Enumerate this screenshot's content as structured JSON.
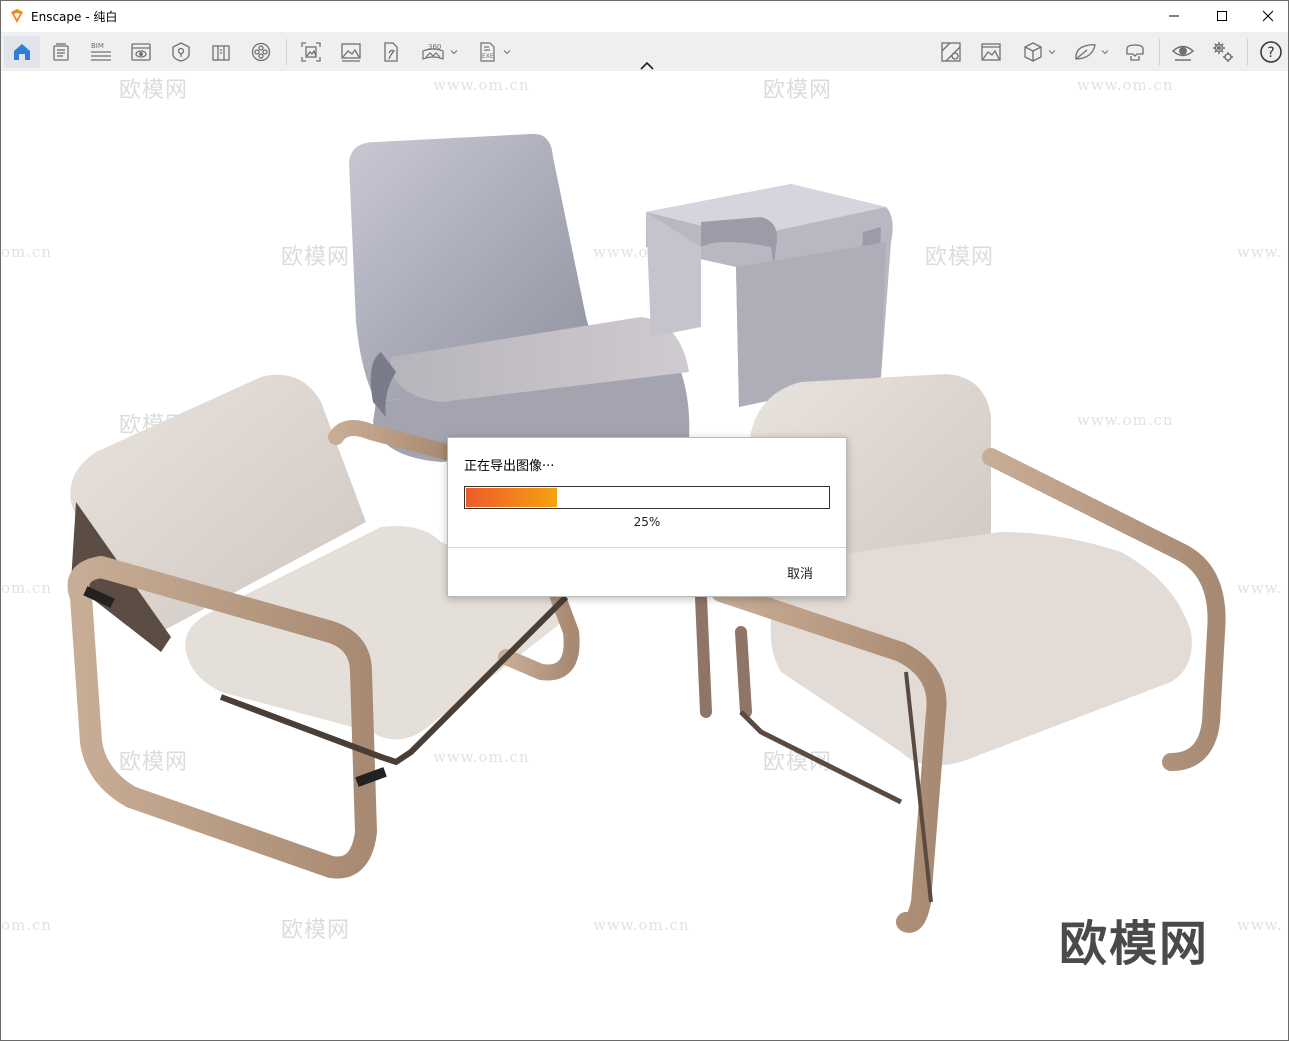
{
  "window": {
    "title": "Enscape - 纯白",
    "controls": [
      "minimize",
      "maximize",
      "close"
    ]
  },
  "toolbar": {
    "left_icons": [
      "home-icon",
      "asset-library-icon",
      "bim-icon",
      "visual-settings-icon",
      "views-icon",
      "material-editor-icon",
      "video-editor-icon"
    ],
    "export_icons": [
      "screenshot-icon",
      "batch-render-icon",
      "export-icon",
      "panorama-360-icon",
      "exe-export-icon"
    ],
    "bim_label": "BIM",
    "panorama_label": "360",
    "exe_label": "EXE",
    "right_icons": [
      "map-icon",
      "image-icon",
      "cube-icon",
      "shape-icon",
      "vr-headset-icon",
      "eye-icon",
      "settings-gears-icon",
      "help-icon"
    ],
    "help_label": "?"
  },
  "viewport": {
    "watermark_text": "欧模网",
    "watermark_url": "www.om.cn",
    "watermark_url_partial": "om.cn",
    "watermark_url_cut": "www.",
    "brand_watermark": "欧模网"
  },
  "export_dialog": {
    "title": "正在导出图像···",
    "progress": 0.25,
    "progress_label": "25%",
    "cancel_label": "取消",
    "colors": {
      "fill_start": "#ee5a2a",
      "fill_end": "#f4a20f"
    }
  },
  "colors": {
    "toolbar_bg": "#efefef",
    "accent_blue": "#2f7fd6",
    "logo_orange": "#f08a1e"
  }
}
